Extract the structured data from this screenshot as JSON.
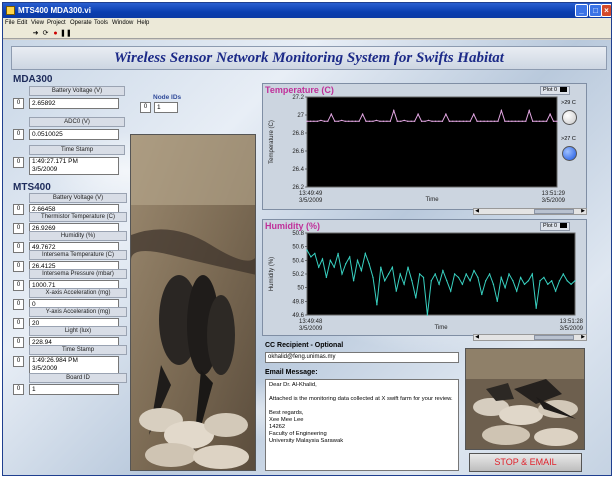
{
  "window": {
    "title": "MTS400 MDA300.vi"
  },
  "menu": [
    "File",
    "Edit",
    "View",
    "Project",
    "Operate",
    "Tools",
    "Window",
    "Help"
  ],
  "banner": "Wireless Sensor Network Monitoring System for Swifts Habitat",
  "mda300": {
    "heading": "MDA300",
    "node_ids_label": "Node IDs",
    "node_ids": {
      "index": "0",
      "value": "1"
    },
    "fields": [
      {
        "label": "Battery Voltage (V)",
        "index": "0",
        "value": "2.65892"
      },
      {
        "label": "ADC0 (V)",
        "index": "0",
        "value": "0.0510025"
      },
      {
        "label": "Time Stamp",
        "index": "0",
        "value": "1:49:27.171 PM\n3/5/2009"
      }
    ]
  },
  "mts400": {
    "heading": "MTS400",
    "fields": [
      {
        "label": "Battery Voltage (V)",
        "index": "0",
        "value": "2.66458"
      },
      {
        "label": "Thermistor Temperature (C)",
        "index": "0",
        "value": "26.9269"
      },
      {
        "label": "Humidity (%)",
        "index": "0",
        "value": "49.7672"
      },
      {
        "label": "Intersema Temperature (C)",
        "index": "0",
        "value": "26.4125"
      },
      {
        "label": "Intersema Pressure (mbar)",
        "index": "0",
        "value": "1000.71"
      },
      {
        "label": "X-axis Acceleration (mg)",
        "index": "0",
        "value": "0"
      },
      {
        "label": "Y-axis Acceleration (mg)",
        "index": "0",
        "value": "20"
      },
      {
        "label": "Light (lux)",
        "index": "0",
        "value": "228.94"
      },
      {
        "label": "Time Stamp",
        "index": "0",
        "value": "1:49:26.984 PM\n3/5/2009"
      },
      {
        "label": "Board ID",
        "index": "0",
        "value": "1"
      }
    ]
  },
  "indicators": {
    "high_label": ">29 C",
    "low_label": ">27 C",
    "high_color": "#c8c8c8",
    "low_color": "#1a55e0"
  },
  "email": {
    "cc_label": "CC Recipient - Optional",
    "cc_value": "okhalid@feng.unimas.my",
    "message_label": "Email Message:",
    "message": "Dear Dr. Al-Khalid,\n\nAttached is the monitoring data collected at X swift farm for your review.\n\nBest regards,\nXee Mee Lee\n14262\nFaculty of Engineering\nUniversity Malaysia Sarawak",
    "button": "STOP & EMAIL"
  },
  "chart_data": [
    {
      "type": "line",
      "title": "Temperature (C)",
      "xlabel": "Time",
      "ylabel": "Temperature (C)",
      "legend": "Plot 0",
      "ylim": [
        26.2,
        27.2
      ],
      "yticks": [
        "27.2",
        "27",
        "26.8",
        "26.6",
        "26.4",
        "26.2"
      ],
      "xticks": [
        [
          "13:49:49",
          "3/5/2009"
        ],
        [
          "13:51:29",
          "3/5/2009"
        ]
      ],
      "line_color": "#e2a6e2",
      "series": [
        {
          "values": [
            26.93,
            26.93,
            26.93,
            26.93,
            26.94,
            26.93,
            26.93,
            27.01,
            26.93,
            26.93,
            26.94,
            26.93,
            26.93,
            26.93,
            26.93,
            26.93,
            27.01,
            26.93,
            26.93,
            26.93,
            26.94,
            26.93,
            26.93,
            26.93,
            26.93,
            27.05,
            26.93,
            26.93,
            26.94,
            26.93,
            26.93,
            26.93,
            27.01,
            26.93,
            26.93,
            26.94,
            26.93,
            26.93,
            26.93,
            26.93,
            27.01,
            26.93,
            26.93,
            26.93,
            26.93,
            26.93,
            26.93,
            26.93,
            27.01,
            26.93,
            26.93,
            26.93,
            26.93,
            26.93,
            26.93,
            26.93,
            27.05,
            26.93,
            26.93,
            26.93,
            26.93,
            26.93,
            26.93,
            26.93,
            27.05,
            26.93,
            26.93,
            26.93,
            26.93,
            26.93,
            27.01,
            26.93,
            26.93
          ]
        }
      ]
    },
    {
      "type": "line",
      "title": "Humidity (%)",
      "xlabel": "Time",
      "ylabel": "Humidity (%)",
      "legend": "Plot 0",
      "ylim": [
        49.6,
        50.8
      ],
      "yticks": [
        "50.8",
        "50.6",
        "50.4",
        "50.2",
        "50",
        "49.8",
        "49.6"
      ],
      "xticks": [
        [
          "13:49:48",
          "3/5/2009"
        ],
        [
          "13:51:28",
          "3/5/2009"
        ]
      ],
      "line_color": "#38d0c0",
      "series": [
        {
          "values": [
            50.55,
            50.45,
            50.5,
            50.3,
            50.42,
            50.15,
            50.4,
            50.3,
            50.5,
            50.2,
            50.35,
            50.45,
            50.1,
            50.4,
            50.25,
            50.5,
            50.35,
            50.15,
            49.75,
            50.3,
            50.1,
            50.2,
            50.3,
            49.95,
            50.2,
            50.05,
            50.3,
            50.1,
            49.85,
            50.2,
            50.15,
            49.6,
            50.1,
            50.2,
            50.05,
            50.25,
            50.1,
            49.95,
            50.2,
            50.15,
            50.05,
            50.2,
            50.1,
            50.25,
            50.15,
            49.9,
            50.1,
            50.2,
            50.05,
            49.8,
            50.15,
            50.0,
            50.2,
            50.1,
            49.95,
            50.15,
            50.05,
            50.1,
            50.2,
            49.7,
            50.1,
            50.15,
            50.05,
            50.1,
            49.95,
            50.1,
            50.2,
            50.1,
            50.05,
            50.1
          ]
        }
      ]
    }
  ]
}
